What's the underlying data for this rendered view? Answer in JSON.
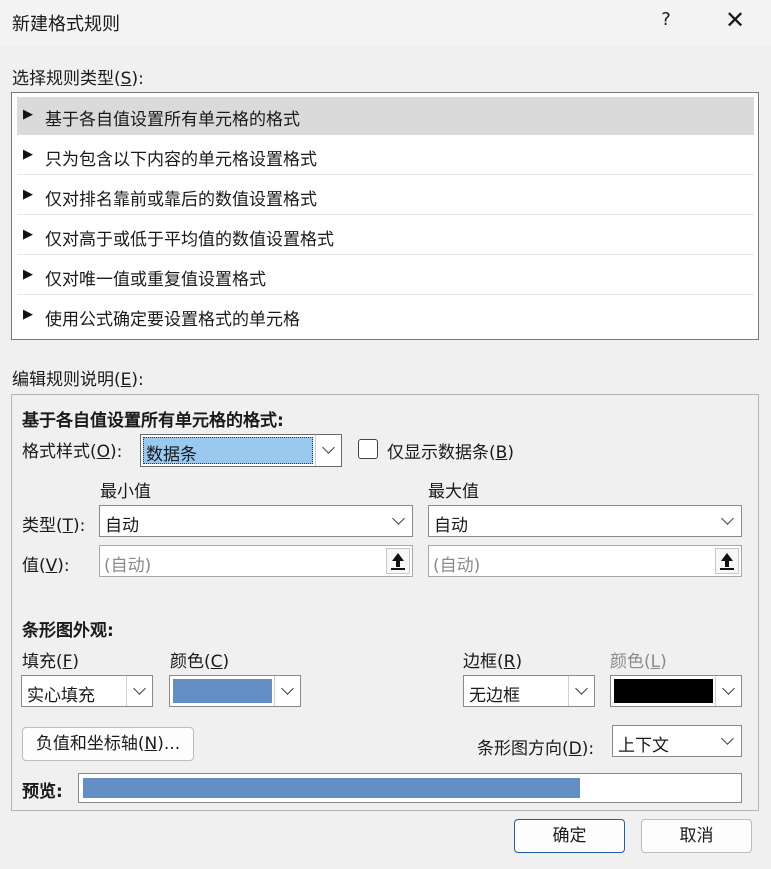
{
  "dialog": {
    "title": "新建格式规则",
    "help_icon": "?",
    "close_icon": "✕"
  },
  "select_rule_type": {
    "label_prefix": "选择规则类型(",
    "label_key": "S",
    "label_suffix": "):",
    "items": [
      {
        "label": "基于各自值设置所有单元格的格式",
        "selected": true
      },
      {
        "label": "只为包含以下内容的单元格设置格式",
        "selected": false
      },
      {
        "label": "仅对排名靠前或靠后的数值设置格式",
        "selected": false
      },
      {
        "label": "仅对高于或低于平均值的数值设置格式",
        "selected": false
      },
      {
        "label": "仅对唯一值或重复值设置格式",
        "selected": false
      },
      {
        "label": "使用公式确定要设置格式的单元格",
        "selected": false
      }
    ],
    "marker": "▶"
  },
  "edit_rule": {
    "label_prefix": "编辑规则说明(",
    "label_key": "E",
    "label_suffix": "):",
    "heading": "基于各自值设置所有单元格的格式:",
    "format_style_prefix": "格式样式(",
    "format_style_key": "O",
    "format_style_suffix": "):",
    "format_style_value": "数据条",
    "show_bar_only_prefix": "仅显示数据条(",
    "show_bar_only_key": "B",
    "show_bar_only_suffix": ")",
    "show_bar_only_checked": false,
    "min_header": "最小值",
    "max_header": "最大值",
    "type_prefix": "类型(",
    "type_key": "T",
    "type_suffix": "):",
    "value_prefix": "值(",
    "value_key": "V",
    "value_suffix": "):",
    "min_type": "自动",
    "max_type": "自动",
    "min_value_placeholder": "(自动)",
    "max_value_placeholder": "(自动)"
  },
  "bar_appearance": {
    "heading": "条形图外观:",
    "fill_prefix": "填充(",
    "fill_key": "F",
    "fill_suffix": ")",
    "fill_value": "实心填充",
    "fill_color_prefix": "颜色(",
    "fill_color_key": "C",
    "fill_color_suffix": ")",
    "fill_color": "#638ec6",
    "border_prefix": "边框(",
    "border_key": "R",
    "border_suffix": ")",
    "border_value": "无边框",
    "border_color_prefix": "颜色(",
    "border_color_key": "L",
    "border_color_suffix": ")",
    "border_color": "#000000",
    "negative_axis_prefix": "负值和坐标轴(",
    "negative_axis_key": "N",
    "negative_axis_suffix": ")...",
    "direction_prefix": "条形图方向(",
    "direction_key": "D",
    "direction_suffix": "):",
    "direction_value": "上下文"
  },
  "preview": {
    "label": "预览:",
    "bar_color": "#638ec6",
    "bar_fraction": 0.76
  },
  "footer": {
    "ok": "确定",
    "cancel": "取消"
  }
}
